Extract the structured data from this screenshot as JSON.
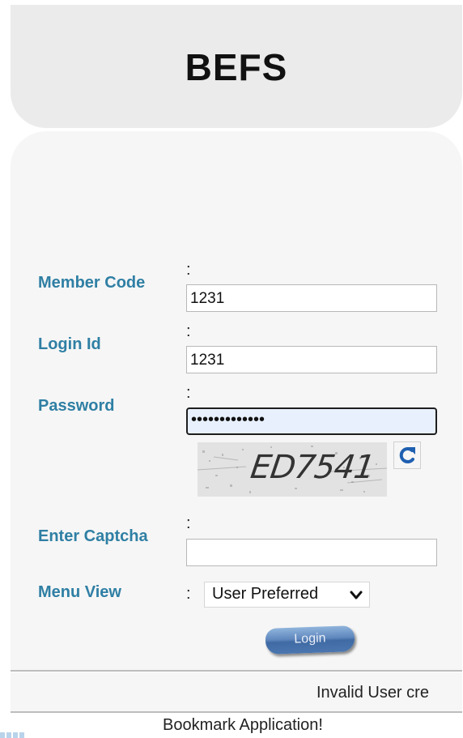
{
  "app": {
    "title": "BEFS"
  },
  "form": {
    "member_code": {
      "label": "Member Code",
      "colon": ":",
      "value": "1231"
    },
    "login_id": {
      "label": "Login Id",
      "colon": ":",
      "value": "1231"
    },
    "password": {
      "label": "Password",
      "colon": ":",
      "value": "•••••••••••••"
    },
    "captcha": {
      "image_text": "ED7541",
      "refresh_icon": "refresh-icon"
    },
    "enter_captcha": {
      "label": "Enter Captcha",
      "colon": ":",
      "value": ""
    },
    "menu_view": {
      "label": "Menu View",
      "colon": ":",
      "selected": "User Preferred",
      "chevron_icon": "chevron-down-icon"
    },
    "login_button": {
      "label": "Login"
    }
  },
  "status": {
    "message": "Invalid User cre"
  },
  "footer": {
    "bookmark_text": "Bookmark Application!"
  },
  "colors": {
    "label": "#2f7fa4",
    "header_bg": "#ebebeb",
    "panel_bg": "#f6f6f6",
    "button": "#4b76b0",
    "refresh_icon": "#1f5fb0"
  }
}
